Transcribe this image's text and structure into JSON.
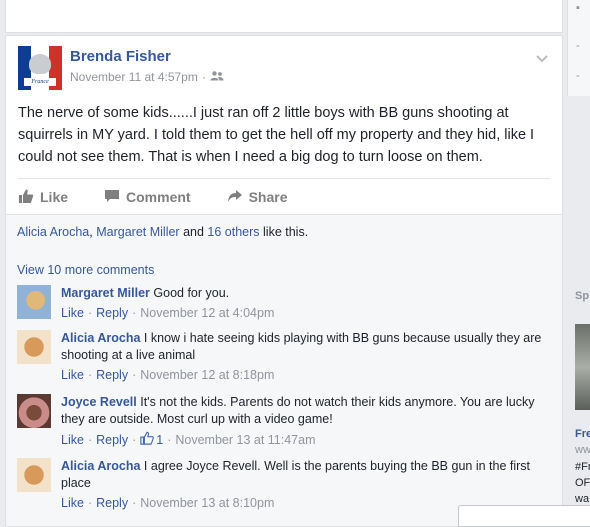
{
  "post": {
    "author": "Brenda Fisher",
    "avatar_caption": "France",
    "timestamp": "November 11 at 4:57pm",
    "privacy_sep": "·",
    "text": "The nerve of some kids......I just ran off 2 little boys with BB guns shooting at squirrels in MY yard. I told them to get the hell off my property and they hid, like I could not see them. That is when I need a big dog to turn loose on them.",
    "actions": {
      "like": "Like",
      "comment": "Comment",
      "share": "Share"
    }
  },
  "likes": {
    "name1": "Alicia Arocha",
    "sep": ",",
    "name2": "Margaret Miller",
    "and": "and",
    "others": "16 others",
    "suffix": "like this."
  },
  "view_more": "View 10 more comments",
  "comments": [
    {
      "author": "Margaret Miller",
      "text": "Good for you.",
      "like": "Like",
      "reply": "Reply",
      "timestamp": "November 12 at 4:04pm",
      "reactions": ""
    },
    {
      "author": "Alicia Arocha",
      "text": "I know i hate seeing kids playing with BB guns because usually they are shooting at a live animal",
      "like": "Like",
      "reply": "Reply",
      "timestamp": "November 12 at 8:18pm",
      "reactions": ""
    },
    {
      "author": "Joyce Revell",
      "text": "It's not the kids. Parents do not watch their kids anymore. You are lucky they are outside. Most curl up with a video game!",
      "like": "Like",
      "reply": "Reply",
      "timestamp": "November 13 at 11:47am",
      "reactions": "1"
    },
    {
      "author": "Alicia Arocha",
      "text": "I agree Joyce Revell. Well is the parents buying the BB gun in the first place",
      "like": "Like",
      "reply": "Reply",
      "timestamp": "November 13 at 8:10pm",
      "reactions": ""
    }
  ],
  "right_column": {
    "sponsored_label": "Sp",
    "ad_title": "Fre",
    "ad_url": "ww",
    "ad_line1": "#Fr",
    "ad_line2": "OF",
    "ad_line3": "wa"
  },
  "colors": {
    "link": "#365899",
    "meta": "#90949c",
    "background": "#e9ebee"
  }
}
